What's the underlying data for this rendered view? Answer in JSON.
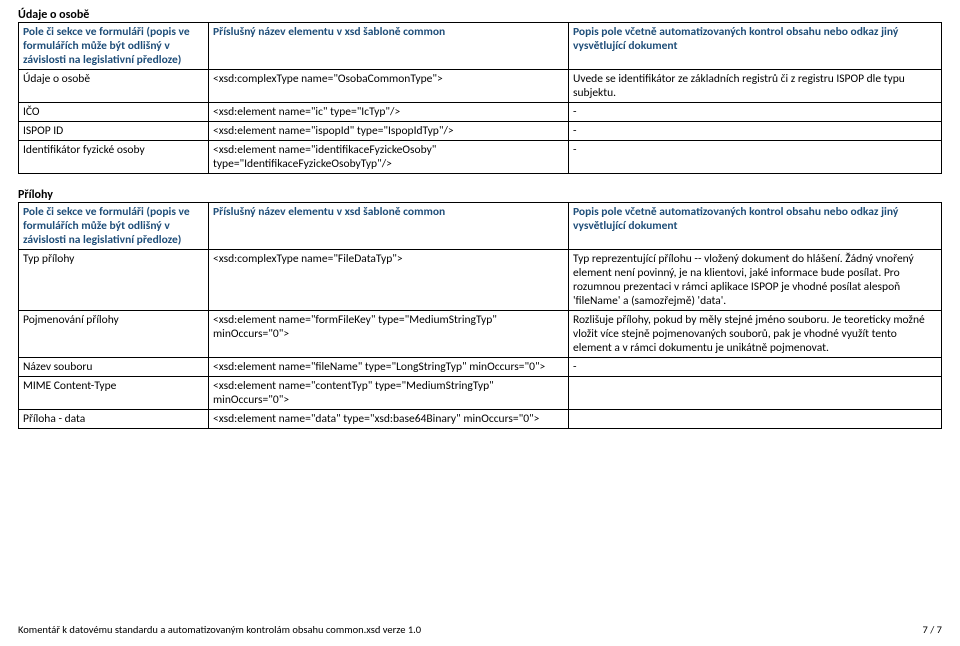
{
  "section1": {
    "title": "Údaje o osobě",
    "headers": {
      "h1": "Pole či sekce ve formuláři (popis ve formulářích může být odlišný v závislosti na legislativní předloze)",
      "h2": "Příslušný název elementu v xsd šabloně common",
      "h3": "Popis pole včetně automatizovaných kontrol obsahu nebo odkaz jiný vysvětlující dokument"
    },
    "rows": [
      {
        "c1": "Údaje o osobě",
        "c2": "<xsd:complexType name=\"OsobaCommonType\">",
        "c3": "Uvede se identifikátor ze základních registrů či z registru ISPOP dle typu subjektu."
      },
      {
        "c1": "IČO",
        "c2": "<xsd:element name=\"ic\" type=\"IcTyp\"/>",
        "c3": "-"
      },
      {
        "c1": "ISPOP ID",
        "c2": "<xsd:element name=\"ispopId\" type=\"IspopIdTyp\"/>",
        "c3": "-"
      },
      {
        "c1": "Identifikátor fyzické osoby",
        "c2": "<xsd:element name=\"identifikaceFyzickeOsoby\" type=\"IdentifikaceFyzickeOsobyTyp\"/>",
        "c3": "-"
      }
    ]
  },
  "section2": {
    "title": "Přílohy",
    "headers": {
      "h1": "Pole či sekce ve formuláři (popis ve formulářích může být odlišný v závislosti na legislativní předloze)",
      "h2": "Příslušný název elementu v xsd šabloně common",
      "h3": "Popis pole včetně automatizovaných kontrol obsahu nebo odkaz jiný vysvětlující dokument"
    },
    "rows": [
      {
        "c1": "Typ přílohy",
        "c2": "<xsd:complexType name=\"FileDataTyp\">",
        "c3": "Typ reprezentující přílohu -- vložený dokument do hlášení.  Žádný vnořený element není povinný, je na klientovi, jaké informace bude posílat.  Pro rozumnou prezentaci v rámci aplikace ISPOP je vhodné posílat alespoň 'fileName' a (samozřejmě) 'data'."
      },
      {
        "c1": "Pojmenování přílohy",
        "c2": "<xsd:element name=\"formFileKey\" type=\"MediumStringTyp\" minOccurs=\"0\">",
        "c3": "Rozlišuje přílohy, pokud by měly stejné jméno souboru.  Je teoreticky možné vložit více stejně pojmenovaných souborů, pak je vhodné využít tento element a v rámci dokumentu je unikátně pojmenovat."
      },
      {
        "c1": "Název souboru",
        "c2": "<xsd:element name=\"fileName\" type=\"LongStringTyp\" minOccurs=\"0\">",
        "c3": "-"
      },
      {
        "c1": "MIME Content-Type",
        "c2": "<xsd:element name=\"contentTyp\" type=\"MediumStringTyp\" minOccurs=\"0\">",
        "c3": ""
      },
      {
        "c1": "Příloha - data",
        "c2": "<xsd:element name=\"data\" type=\"xsd:base64Binary\" minOccurs=\"0\">",
        "c3": ""
      }
    ]
  },
  "footer": {
    "left": "Komentář k datovému standardu a automatizovaným kontrolám obsahu common.xsd verze 1.0",
    "right": "7 / 7"
  }
}
